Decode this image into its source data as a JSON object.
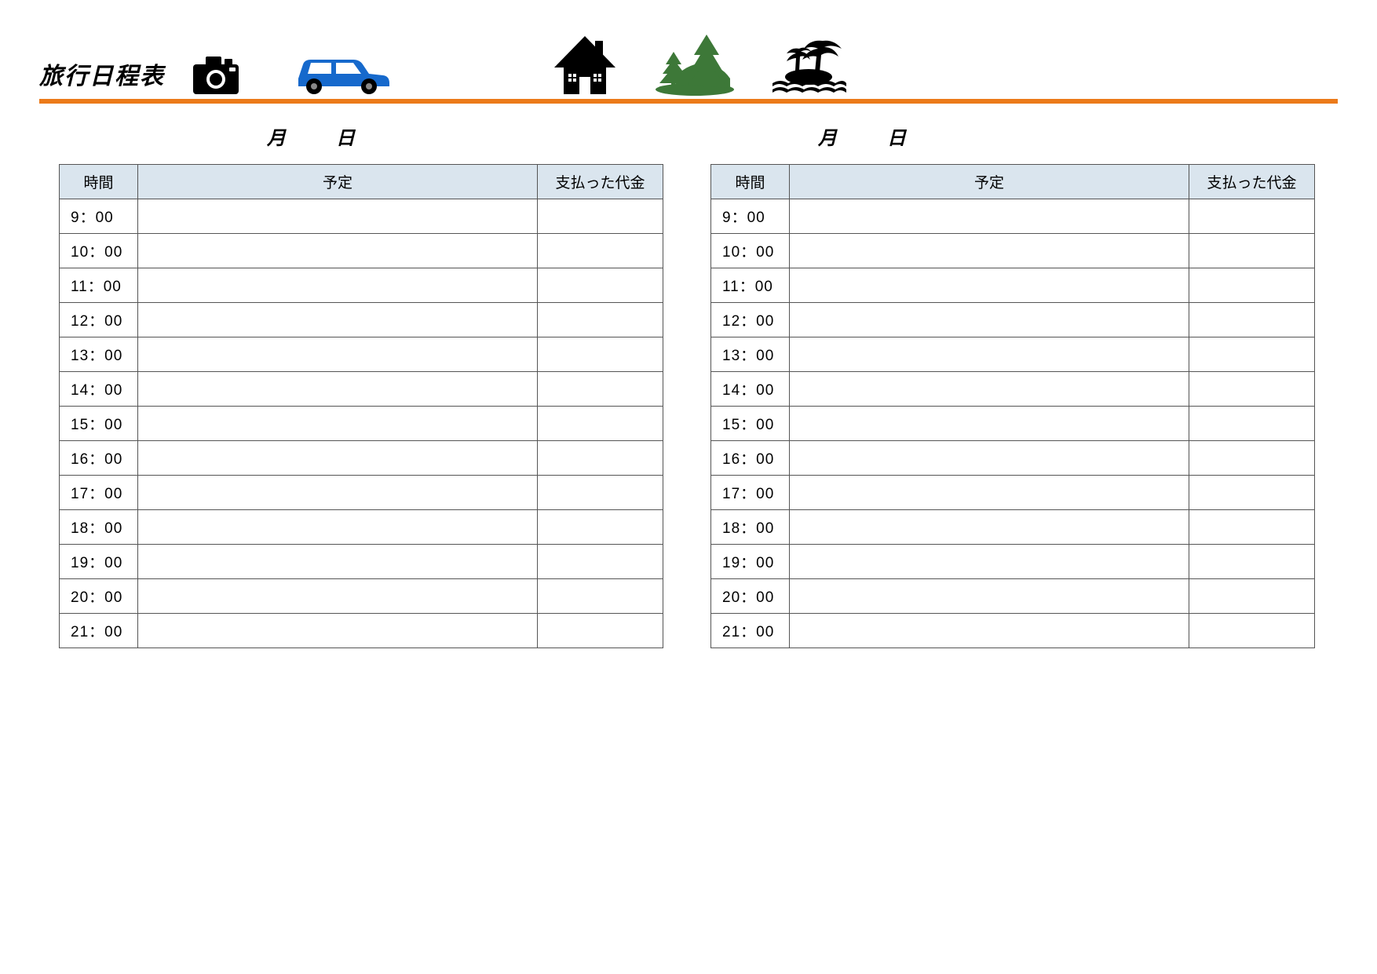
{
  "title": "旅行日程表",
  "date_label": "月　日",
  "columns": {
    "time": "時間",
    "plan": "予定",
    "cost": "支払った代金"
  },
  "times": [
    "9：00",
    "10：00",
    "11：00",
    "12：00",
    "13：00",
    "14：00",
    "15：00",
    "16：00",
    "17：00",
    "18：00",
    "19：00",
    "20：00",
    "21：00"
  ],
  "icons": [
    "camera-icon",
    "car-icon",
    "house-icon",
    "trees-icon",
    "island-icon"
  ],
  "colors": {
    "accent": "#ec7a1a",
    "header_bg": "#dae5ee",
    "car": "#1669cc",
    "tree": "#3d7838"
  }
}
